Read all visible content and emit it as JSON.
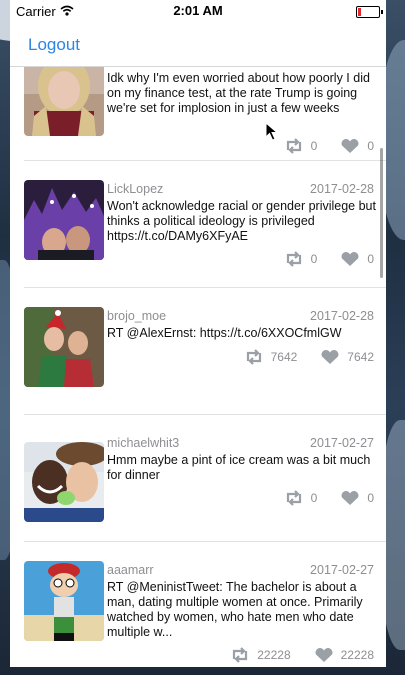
{
  "status_bar": {
    "carrier": "Carrier",
    "time": "2:01 AM"
  },
  "nav": {
    "logout_label": "Logout"
  },
  "tweets": [
    {
      "username": "",
      "date": "",
      "text": "Idk why I'm even worried about how poorly I did on my finance test, at the rate Trump is going we're set for implosion in just a few weeks",
      "retweets": "0",
      "likes": "0"
    },
    {
      "username": "LickLopez",
      "date": "2017-02-28",
      "text": "Won't acknowledge racial or gender privilege but thinks a political ideology is privileged https://t.co/DAMy6XFyAE",
      "retweets": "0",
      "likes": "0"
    },
    {
      "username": "brojo_moe",
      "date": "2017-02-28",
      "text": "RT @AlexErnst: https://t.co/6XXOCfmlGW",
      "retweets": "7642",
      "likes": "7642"
    },
    {
      "username": "michaelwhit3",
      "date": "2017-02-27",
      "text": "Hmm maybe a pint of ice cream was a bit much for dinner",
      "retweets": "0",
      "likes": "0"
    },
    {
      "username": "aaamarr",
      "date": "2017-02-27",
      "text": "RT @MeninistTweet: The bachelor is about a man, dating multiple women at once. Primarily watched by women, who hate men who date multiple w...",
      "retweets": "22228",
      "likes": "22228"
    }
  ],
  "colors": {
    "accent": "#2c86e5",
    "meta_text": "#8e8e93",
    "icon": "#9aa0a6"
  }
}
